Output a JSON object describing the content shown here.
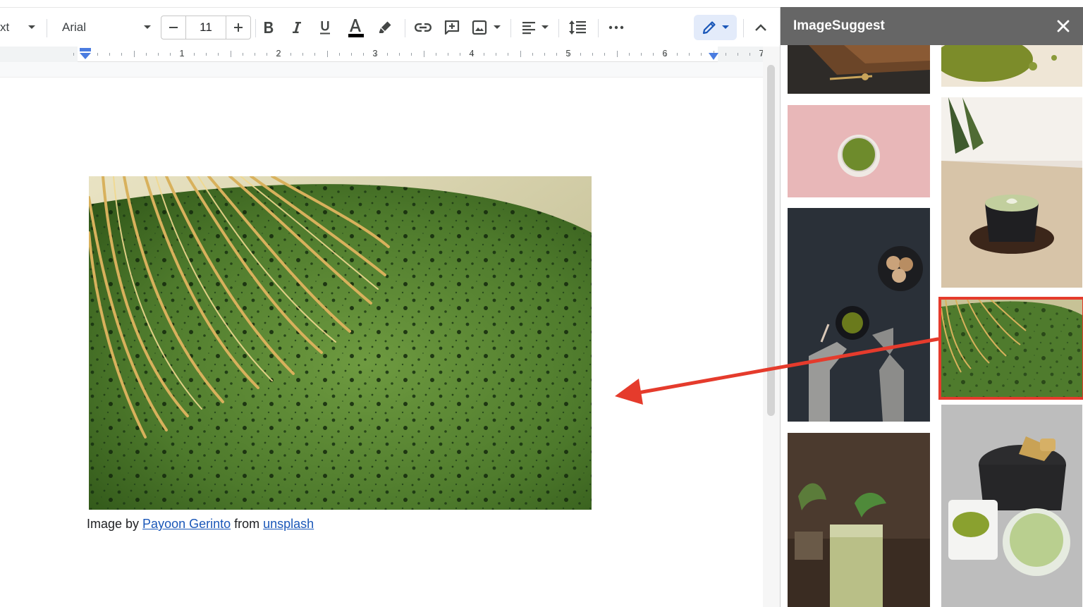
{
  "toolbar": {
    "style_label": "xt",
    "font_name": "Arial",
    "font_size": "11",
    "icons": [
      "dropdown-icon",
      "decrease-font-icon",
      "increase-font-icon",
      "bold-icon",
      "italic-icon",
      "underline-icon",
      "text-color-icon",
      "highlight-icon",
      "link-icon",
      "add-comment-icon",
      "insert-image-icon",
      "align-icon",
      "line-spacing-icon",
      "more-icon",
      "edit-mode-icon",
      "collapse-icon"
    ],
    "text_color": "#000000"
  },
  "ruler": {
    "numbers": [
      "1",
      "2",
      "3",
      "4",
      "5",
      "6",
      "7"
    ]
  },
  "document": {
    "caption_prefix": "Image by ",
    "caption_author": "Payoon Gerinto",
    "caption_middle": " from ",
    "caption_source": "unsplash"
  },
  "panel": {
    "title": "ImageSuggest",
    "close_icon": "close-icon",
    "highlight_color": "#e53b2c"
  },
  "colors": {
    "accent": "#1a57b8",
    "panel_header": "#666666",
    "annotation": "#e53b2c"
  }
}
